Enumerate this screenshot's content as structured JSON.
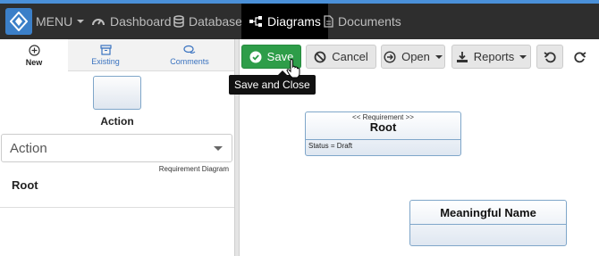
{
  "nav": {
    "menu_label": "MENU",
    "items": [
      {
        "label": "Dashboard",
        "icon": "gauge-icon"
      },
      {
        "label": "Database",
        "icon": "database-icon"
      },
      {
        "label": "Diagrams",
        "icon": "diagram-icon",
        "active": true
      },
      {
        "label": "Documents",
        "icon": "document-icon"
      }
    ],
    "accent": "#3b7fc8",
    "bar_color": "#2e2e2e"
  },
  "left_panel": {
    "tabs": [
      {
        "label": "New",
        "icon": "plus-circle-icon",
        "active": true
      },
      {
        "label": "Existing",
        "icon": "archive-icon"
      },
      {
        "label": "Comments",
        "icon": "comments-icon"
      }
    ],
    "shape_label": "Action",
    "select_value": "Action",
    "diagram_type": "Requirement Diagram",
    "tree_item": "Root"
  },
  "toolbar": {
    "save_label": "Save",
    "cancel_label": "Cancel",
    "open_label": "Open",
    "reports_label": "Reports",
    "save_color": "#2e9d49"
  },
  "tooltip": "Save and Close",
  "canvas": {
    "root_node": {
      "stereotype": "<< Requirement >>",
      "title": "Root",
      "attribute": "Status = Draft"
    },
    "second_node": {
      "title": "Meaningful Name"
    }
  }
}
